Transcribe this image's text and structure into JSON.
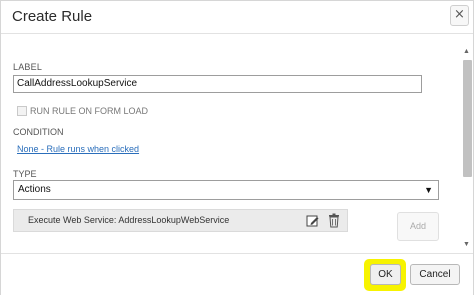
{
  "dialog": {
    "title": "Create Rule",
    "close_glyph": "×"
  },
  "form": {
    "label_caption": "LABEL",
    "label_value": "CallAddressLookupService",
    "run_rule_label": "RUN RULE ON FORM LOAD",
    "run_rule_checked": false,
    "condition_caption": "CONDITION",
    "condition_link": "None - Rule runs when clicked",
    "type_caption": "TYPE",
    "type_selected": "Actions",
    "select_arrow": "▼"
  },
  "actions": [
    {
      "text": "Execute Web Service: AddressLookupWebService",
      "icons": [
        "edit-icon",
        "trash-icon"
      ]
    }
  ],
  "add_button": "Add",
  "scrollbar": {
    "up": "▲",
    "down": "▼"
  },
  "footer": {
    "ok_label": "OK",
    "cancel_label": "Cancel",
    "highlight_color": "#f7f300"
  }
}
